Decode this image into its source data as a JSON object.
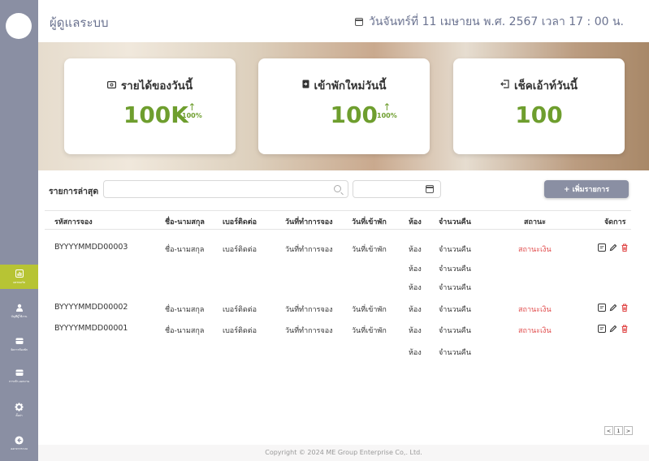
{
  "sidebar": {
    "items": [
      {
        "label": "แดชบอร์ด",
        "icon": "chart-icon",
        "active": true
      },
      {
        "label": "บัญชีผู้ใช้งาน",
        "icon": "user-icon"
      },
      {
        "label": "จัดการห้องพัก",
        "icon": "room-icon"
      },
      {
        "label": "การเข้า-ออกงาน",
        "icon": "attendance-icon"
      },
      {
        "label": "ตั้งค่า",
        "icon": "gear-icon"
      },
      {
        "label": "ออกจากระบบ",
        "icon": "logout-icon"
      }
    ]
  },
  "header": {
    "title": "ผู้ดูแลระบบ",
    "datetime": "วันจันทร์ที่ 11 เมษายน พ.ศ. 2567 เวลา 17 : 00 น."
  },
  "cards": [
    {
      "title": "รายได้ของวันนี้",
      "value": "100K",
      "trend": "100%",
      "icon": "money-icon"
    },
    {
      "title": "เข้าพักใหม่วันนี้",
      "value": "100",
      "trend": "100%",
      "icon": "checkin-icon"
    },
    {
      "title": "เช็คเอ้าท์วันนี้",
      "value": "100",
      "icon": "checkout-icon"
    }
  ],
  "toolbar": {
    "label": "รายการล่าสุด",
    "search_placeholder": "",
    "date_placeholder": "",
    "add_label": "+ เพิ่มรายการ"
  },
  "table": {
    "headers": [
      "รหัสการจอง",
      "ชื่อ-นามสกุล",
      "เบอร์ติดต่อ",
      "วันที่ทำการจอง",
      "วันที่เข้าพัก",
      "ห้อง",
      "จำนวนคืน",
      "สถานะ",
      "จัดการ"
    ],
    "rows": [
      {
        "code": "BYYYYMMDD00003",
        "name": "ชื่อ-นามสกุล",
        "phone": "เบอร์ติดต่อ",
        "booked": "วันที่ทำการจอง",
        "checkin": "วันที่เข้าพัก",
        "rooms": [
          "ห้อง",
          "ห้อง",
          "ห้อง"
        ],
        "nights": [
          "จำนวนคืน",
          "จำนวนคืน",
          "จำนวนคืน"
        ],
        "status": "สถานะเงิน"
      },
      {
        "code": "BYYYYMMDD00002",
        "name": "ชื่อ-นามสกุล",
        "phone": "เบอร์ติดต่อ",
        "booked": "วันที่ทำการจอง",
        "checkin": "วันที่เข้าพัก",
        "rooms": [
          "ห้อง"
        ],
        "nights": [
          "จำนวนคืน"
        ],
        "status": "สถานะเงิน"
      },
      {
        "code": "BYYYYMMDD00001",
        "name": "ชื่อ-นามสกุล",
        "phone": "เบอร์ติดต่อ",
        "booked": "วันที่ทำการจอง",
        "checkin": "วันที่เข้าพัก",
        "rooms": [
          "ห้อง",
          "ห้อง"
        ],
        "nights": [
          "จำนวนคืน",
          "จำนวนคืน"
        ],
        "status": "สถานะเงิน"
      }
    ]
  },
  "pagination": {
    "prev": "<",
    "page": "1",
    "next": ">"
  },
  "footer": {
    "text": "Copyright © 2024 ME Group Enterprise Co,. Ltd."
  },
  "colors": {
    "sidebar": "#8a8fa3",
    "active": "#b7c434",
    "accent_green": "#6e9e2e",
    "status_red": "#e04848"
  }
}
